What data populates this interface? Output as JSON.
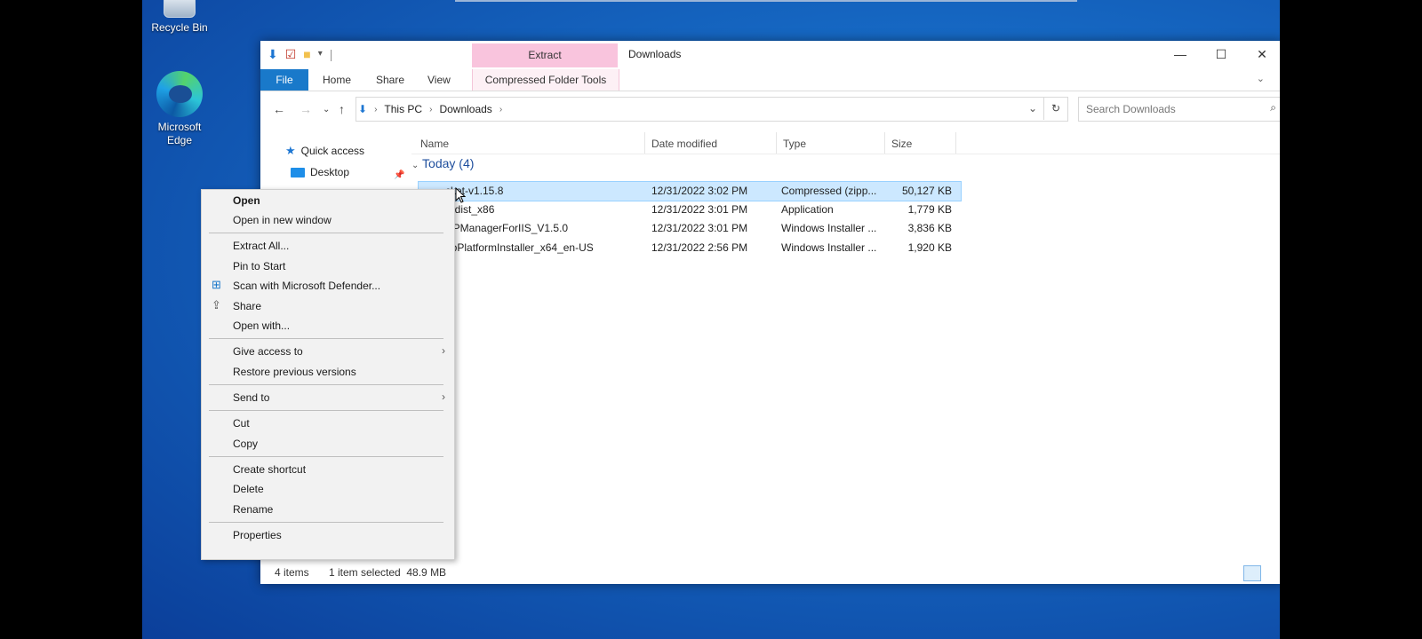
{
  "desktop": {
    "icons": [
      {
        "label": "Recycle Bin"
      },
      {
        "label": "Microsoft Edge"
      }
    ]
  },
  "window": {
    "title": "Downloads",
    "tool_tab_header": "Extract",
    "ribbon_tabs": [
      "File",
      "Home",
      "Share",
      "View",
      "Compressed Folder Tools"
    ],
    "breadcrumb": [
      "This PC",
      "Downloads"
    ],
    "search_placeholder": "Search Downloads",
    "nav": {
      "quick_access": "Quick access",
      "desktop": "Desktop"
    },
    "columns": [
      "Name",
      "Date modified",
      "Type",
      "Size"
    ],
    "group_label": "Today (4)",
    "files": [
      {
        "name": "cket-v1.15.8",
        "date": "12/31/2022 3:02 PM",
        "type": "Compressed (zipp...",
        "size": "50,127 KB",
        "selected": true
      },
      {
        "name": "redist_x86",
        "date": "12/31/2022 3:01 PM",
        "type": "Application",
        "size": "1,779 KB",
        "selected": false
      },
      {
        "name": "HPManagerForIIS_V1.5.0",
        "date": "12/31/2022 3:01 PM",
        "type": "Windows Installer ...",
        "size": "3,836 KB",
        "selected": false
      },
      {
        "name": "ebPlatformInstaller_x64_en-US",
        "date": "12/31/2022 2:56 PM",
        "type": "Windows Installer ...",
        "size": "1,920 KB",
        "selected": false
      }
    ],
    "status": {
      "items": "4 items",
      "selection": "1 item selected  48.9 MB"
    }
  },
  "context_menu": {
    "items": {
      "open": "Open",
      "open_new_window": "Open in new window",
      "extract_all": "Extract All...",
      "pin_to_start": "Pin to Start",
      "scan": "Scan with Microsoft Defender...",
      "share": "Share",
      "open_with": "Open with...",
      "give_access": "Give access to",
      "restore": "Restore previous versions",
      "send_to": "Send to",
      "cut": "Cut",
      "copy": "Copy",
      "create_shortcut": "Create shortcut",
      "delete": "Delete",
      "rename": "Rename",
      "properties": "Properties"
    }
  }
}
